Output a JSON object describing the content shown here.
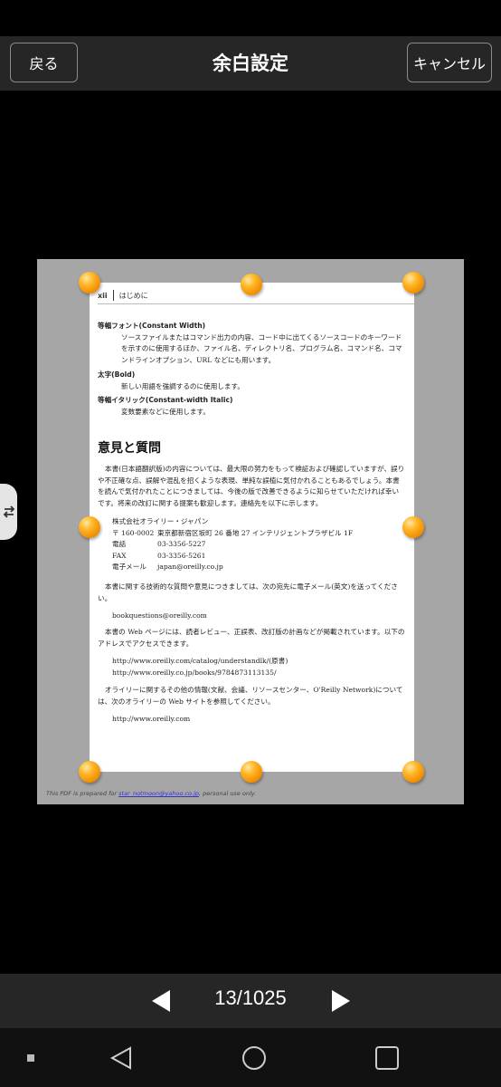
{
  "header": {
    "back_label": "戻る",
    "title": "余白設定",
    "cancel_label": "キャンセル"
  },
  "side_tab": {
    "icon": "swap-arrows-icon"
  },
  "page": {
    "running_head": {
      "page_number": "xii",
      "chapter": "はじめに"
    },
    "entries": [
      {
        "term": "等幅フォント(Constant Width)",
        "desc": "ソースファイルまたはコマンド出力の内容、コード中に出てくるソースコードのキーワードを示すのに使用するほか、ファイル名、ディレクトリ名、プログラム名、コマンド名、コマンドラインオプション、URL などにも用います。"
      },
      {
        "term": "太字(Bold)",
        "desc": "新しい用語を強調するのに使用します。"
      },
      {
        "term": "等幅イタリック(Constant-width Italic)",
        "desc": "変数要素などに使用します。"
      }
    ],
    "section_title": "意見と質問",
    "para1": "本書(日本語翻訳版)の内容については、最大限の努力をもって検証および確認していますが、誤りや不正確な点、誤解や混乱を招くような表現、単純な誤植に気付かれることもあるでしょう。本書を読んで気付かれたことにつきましては、今後の版で改善できるように知らせていただければ幸いです。将来の改訂に関する提案も歓迎します。連絡先を以下に示します。",
    "address": {
      "company": "株式会社オライリー・ジャパン",
      "rows": [
        {
          "k": "〒 160-0002",
          "v": "東京都新宿区坂町 26 番地 27 インテリジェントプラザビル 1F"
        },
        {
          "k": "電話",
          "v": "03-3356-5227"
        },
        {
          "k": "FAX",
          "v": "03-3356-5261"
        },
        {
          "k": "電子メール",
          "v": "japan@oreilly.co.jp"
        }
      ]
    },
    "para2": "本書に関する技術的な質問や意見につきましては、次の宛先に電子メール(英文)を送ってください。",
    "email": "bookquestions@oreilly.com",
    "para3": "本書の Web ページには、読者レビュー、正誤表、改訂版の計画などが掲載されています。以下のアドレスでアクセスできます。",
    "url1": "http://www.oreilly.com/catalog/understandlk/(原書)",
    "url2": "http://www.oreilly.co.jp/books/9784873113135/",
    "para4": "オライリーに関するその他の情報(文献、会議、リソースセンター、O'Reilly Network)については、次のオライリーの Web サイトを参照してください。",
    "url3": "http://www.oreilly.com",
    "footer_prefix": "This PDF is prepared for",
    "footer_email": "star_notmoon@yahoo.co.jp",
    "footer_suffix": ", personal use only."
  },
  "pager": {
    "counter": "13/1025"
  },
  "colors": {
    "handle": "#f5a10f",
    "bar_bg": "#262626",
    "page_bg": "#a6a6a6"
  }
}
